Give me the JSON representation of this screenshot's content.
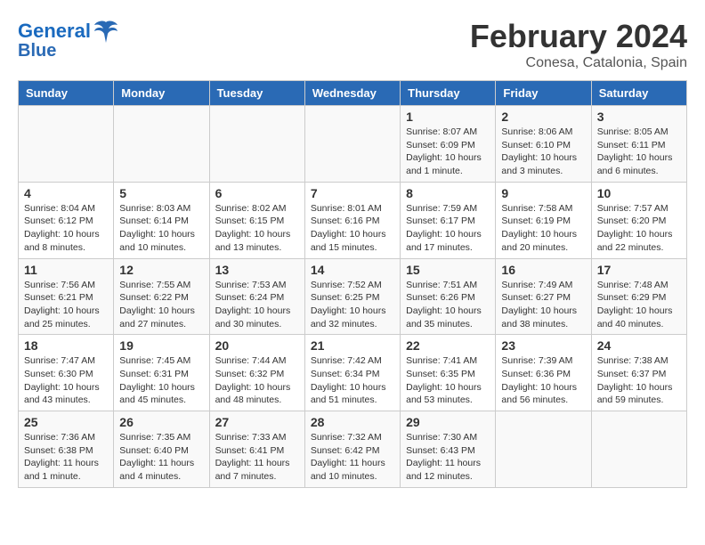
{
  "header": {
    "logo_line1": "General",
    "logo_line2": "Blue",
    "month": "February 2024",
    "location": "Conesa, Catalonia, Spain"
  },
  "weekdays": [
    "Sunday",
    "Monday",
    "Tuesday",
    "Wednesday",
    "Thursday",
    "Friday",
    "Saturday"
  ],
  "weeks": [
    [
      {
        "day": "",
        "detail": ""
      },
      {
        "day": "",
        "detail": ""
      },
      {
        "day": "",
        "detail": ""
      },
      {
        "day": "",
        "detail": ""
      },
      {
        "day": "1",
        "detail": "Sunrise: 8:07 AM\nSunset: 6:09 PM\nDaylight: 10 hours and 1 minute."
      },
      {
        "day": "2",
        "detail": "Sunrise: 8:06 AM\nSunset: 6:10 PM\nDaylight: 10 hours and 3 minutes."
      },
      {
        "day": "3",
        "detail": "Sunrise: 8:05 AM\nSunset: 6:11 PM\nDaylight: 10 hours and 6 minutes."
      }
    ],
    [
      {
        "day": "4",
        "detail": "Sunrise: 8:04 AM\nSunset: 6:12 PM\nDaylight: 10 hours and 8 minutes."
      },
      {
        "day": "5",
        "detail": "Sunrise: 8:03 AM\nSunset: 6:14 PM\nDaylight: 10 hours and 10 minutes."
      },
      {
        "day": "6",
        "detail": "Sunrise: 8:02 AM\nSunset: 6:15 PM\nDaylight: 10 hours and 13 minutes."
      },
      {
        "day": "7",
        "detail": "Sunrise: 8:01 AM\nSunset: 6:16 PM\nDaylight: 10 hours and 15 minutes."
      },
      {
        "day": "8",
        "detail": "Sunrise: 7:59 AM\nSunset: 6:17 PM\nDaylight: 10 hours and 17 minutes."
      },
      {
        "day": "9",
        "detail": "Sunrise: 7:58 AM\nSunset: 6:19 PM\nDaylight: 10 hours and 20 minutes."
      },
      {
        "day": "10",
        "detail": "Sunrise: 7:57 AM\nSunset: 6:20 PM\nDaylight: 10 hours and 22 minutes."
      }
    ],
    [
      {
        "day": "11",
        "detail": "Sunrise: 7:56 AM\nSunset: 6:21 PM\nDaylight: 10 hours and 25 minutes."
      },
      {
        "day": "12",
        "detail": "Sunrise: 7:55 AM\nSunset: 6:22 PM\nDaylight: 10 hours and 27 minutes."
      },
      {
        "day": "13",
        "detail": "Sunrise: 7:53 AM\nSunset: 6:24 PM\nDaylight: 10 hours and 30 minutes."
      },
      {
        "day": "14",
        "detail": "Sunrise: 7:52 AM\nSunset: 6:25 PM\nDaylight: 10 hours and 32 minutes."
      },
      {
        "day": "15",
        "detail": "Sunrise: 7:51 AM\nSunset: 6:26 PM\nDaylight: 10 hours and 35 minutes."
      },
      {
        "day": "16",
        "detail": "Sunrise: 7:49 AM\nSunset: 6:27 PM\nDaylight: 10 hours and 38 minutes."
      },
      {
        "day": "17",
        "detail": "Sunrise: 7:48 AM\nSunset: 6:29 PM\nDaylight: 10 hours and 40 minutes."
      }
    ],
    [
      {
        "day": "18",
        "detail": "Sunrise: 7:47 AM\nSunset: 6:30 PM\nDaylight: 10 hours and 43 minutes."
      },
      {
        "day": "19",
        "detail": "Sunrise: 7:45 AM\nSunset: 6:31 PM\nDaylight: 10 hours and 45 minutes."
      },
      {
        "day": "20",
        "detail": "Sunrise: 7:44 AM\nSunset: 6:32 PM\nDaylight: 10 hours and 48 minutes."
      },
      {
        "day": "21",
        "detail": "Sunrise: 7:42 AM\nSunset: 6:34 PM\nDaylight: 10 hours and 51 minutes."
      },
      {
        "day": "22",
        "detail": "Sunrise: 7:41 AM\nSunset: 6:35 PM\nDaylight: 10 hours and 53 minutes."
      },
      {
        "day": "23",
        "detail": "Sunrise: 7:39 AM\nSunset: 6:36 PM\nDaylight: 10 hours and 56 minutes."
      },
      {
        "day": "24",
        "detail": "Sunrise: 7:38 AM\nSunset: 6:37 PM\nDaylight: 10 hours and 59 minutes."
      }
    ],
    [
      {
        "day": "25",
        "detail": "Sunrise: 7:36 AM\nSunset: 6:38 PM\nDaylight: 11 hours and 1 minute."
      },
      {
        "day": "26",
        "detail": "Sunrise: 7:35 AM\nSunset: 6:40 PM\nDaylight: 11 hours and 4 minutes."
      },
      {
        "day": "27",
        "detail": "Sunrise: 7:33 AM\nSunset: 6:41 PM\nDaylight: 11 hours and 7 minutes."
      },
      {
        "day": "28",
        "detail": "Sunrise: 7:32 AM\nSunset: 6:42 PM\nDaylight: 11 hours and 10 minutes."
      },
      {
        "day": "29",
        "detail": "Sunrise: 7:30 AM\nSunset: 6:43 PM\nDaylight: 11 hours and 12 minutes."
      },
      {
        "day": "",
        "detail": ""
      },
      {
        "day": "",
        "detail": ""
      }
    ]
  ]
}
